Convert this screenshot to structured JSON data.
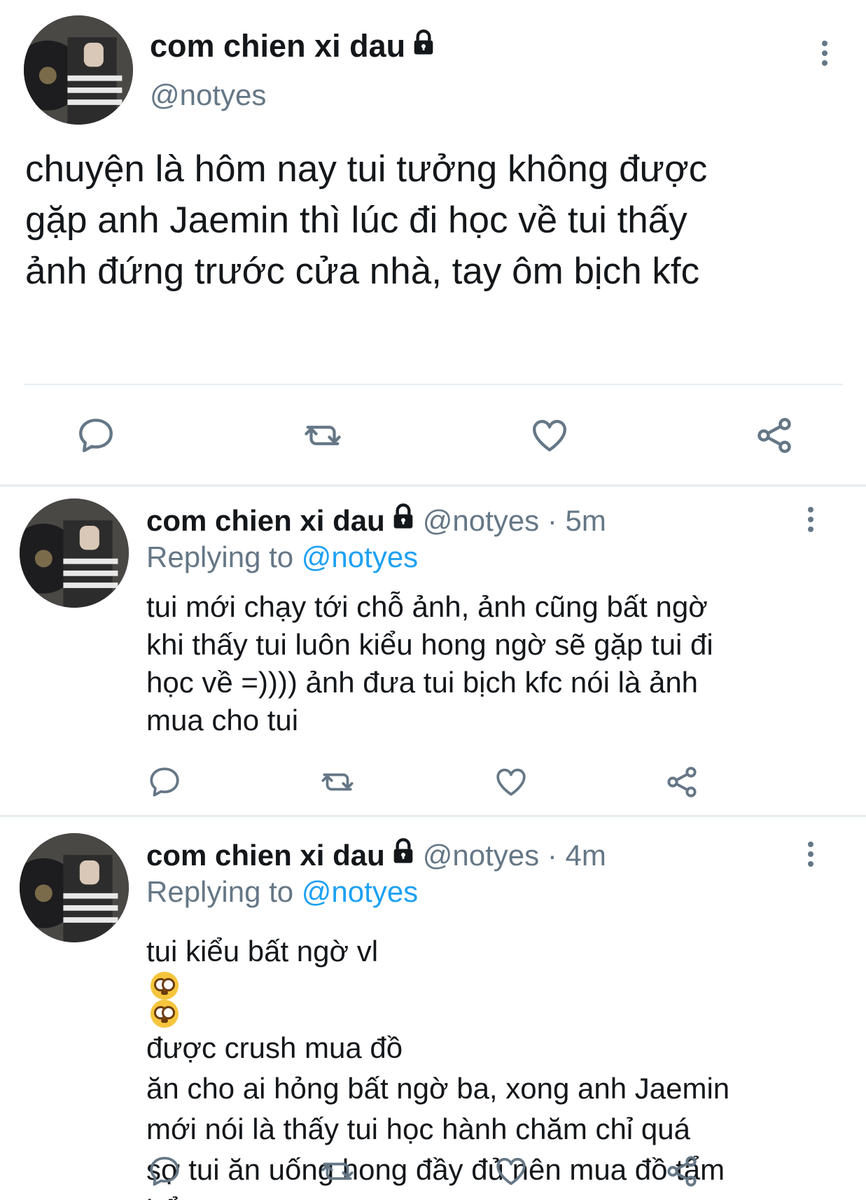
{
  "tweet": {
    "author_name": "com chien xi dau",
    "handle": "@notyes",
    "lines": [
      "chuyện là hôm nay tui tưởng không được",
      "gặp anh Jaemin thì lúc đi học về tui thấy",
      "ảnh đứng trước cửa nhà, tay ôm bịch kfc"
    ]
  },
  "replies": [
    {
      "author_name": "com chien xi dau",
      "meta": "@notyes · 5m",
      "replying_prefix": "Replying to",
      "replying_to": "@notyes",
      "lines": [
        "tui mới chạy tới chỗ ảnh, ảnh cũng bất ngờ",
        "khi thấy tui luôn kiểu hong ngờ sẽ gặp tui đi",
        "học về =)))) ảnh đưa tui bịch kfc nói là ảnh",
        "mua cho tui"
      ]
    },
    {
      "author_name": "com chien xi dau",
      "meta": "@notyes · 4m",
      "replying_prefix": "Replying to",
      "replying_to": "@notyes",
      "first_line_start": "tui kiểu bất ngờ vl",
      "first_line_end": "được crush mua đồ",
      "lines": [
        "ăn cho ai hỏng bất ngờ ba, xong anh Jaemin",
        "mới nói là thấy tui học hành chăm chỉ quá",
        "sợ tui ăn uống hong đầy đủ nên mua đồ tẩm",
        "bổ"
      ]
    }
  ],
  "icons": {
    "lock": "lock-icon",
    "more": "more-vertical-icon",
    "reply": "reply-icon",
    "retweet": "retweet-icon",
    "like": "heart-icon",
    "share": "share-icon",
    "emoji": "flushed-face-emoji"
  },
  "colors": {
    "text": "#14171a",
    "secondary": "#657786",
    "accent": "#1da1f2",
    "divider": "#e6ecf0"
  }
}
